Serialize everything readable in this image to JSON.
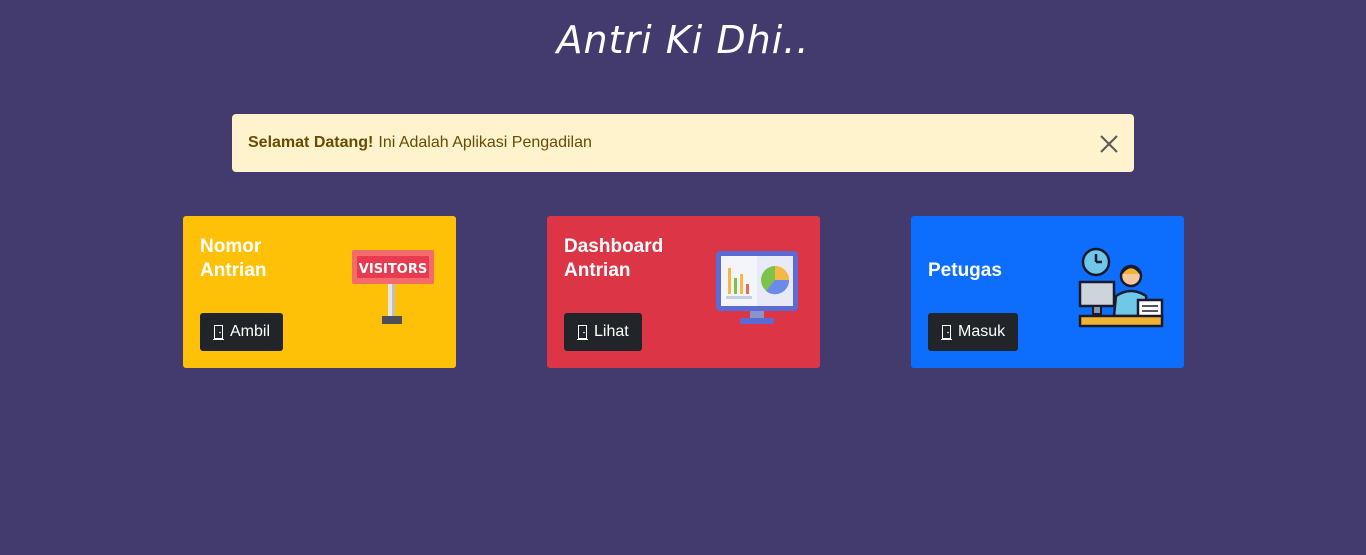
{
  "header": {
    "title": "Antri Ki Dhi.."
  },
  "alert": {
    "strong": "Selamat Datang!",
    "message": "Ini Adalah Aplikasi Pengadilan",
    "close_icon": "close-icon"
  },
  "cards": [
    {
      "title": "Nomor Antrian",
      "button_label": "Ambil",
      "button_icon": "door-icon",
      "illustration": "visitors-sign-icon",
      "illustration_text": "VISITORS",
      "color": "#ffc107"
    },
    {
      "title": "Dashboard Antrian",
      "button_label": "Lihat",
      "button_icon": "door-icon",
      "illustration": "dashboard-monitor-icon",
      "color": "#dc3545"
    },
    {
      "title": "Petugas",
      "button_label": "Masuk",
      "button_icon": "door-icon",
      "illustration": "officer-desk-icon",
      "color": "#0d6efd"
    }
  ],
  "colors": {
    "background": "#433b6d",
    "alert_bg": "#fff3cd",
    "alert_text": "#664d03",
    "button_bg": "#212529"
  }
}
